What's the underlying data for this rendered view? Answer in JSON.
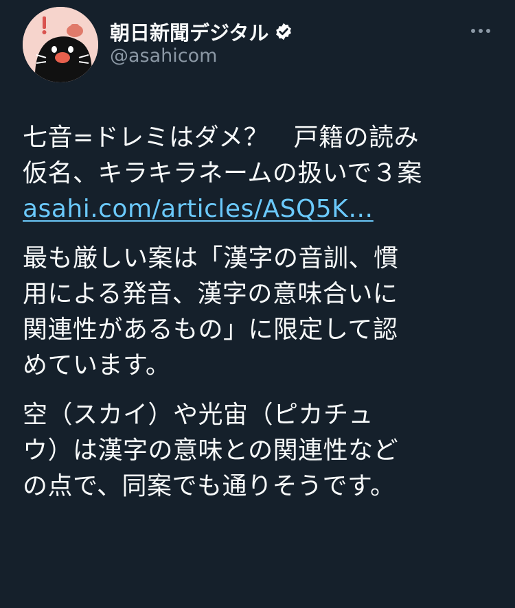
{
  "account": {
    "display_name": "朝日新聞デジタル",
    "handle": "@asahicom",
    "verified_icon": "verified-badge-icon",
    "avatar_icon": "mascot-avatar-icon",
    "more_icon": "more-horizontal-icon"
  },
  "tweet": {
    "para1": {
      "line1": "七音=ドレミはダメ？　戸籍の読み",
      "line2": "仮名、キラキラネームの扱いで３案",
      "link": "asahi.com/articles/ASQ5K…"
    },
    "para2": {
      "line1": "最も厳しい案は「漢字の音訓、慣",
      "line2": "用による発音、漢字の意味合いに",
      "line3": "関連性があるもの」に限定して認",
      "line4": "めています。"
    },
    "para3": {
      "line1": "空（スカイ）や光宙（ピカチュ",
      "line2": "ウ）は漢字の意味との関連性など",
      "line3": "の点で、同案でも通りそうです。"
    }
  },
  "colors": {
    "background": "#15202b",
    "text": "#f7f9f9",
    "secondary_text": "#8b98a5",
    "link": "#6bc9fb",
    "verified_badge": "#ffffff"
  }
}
